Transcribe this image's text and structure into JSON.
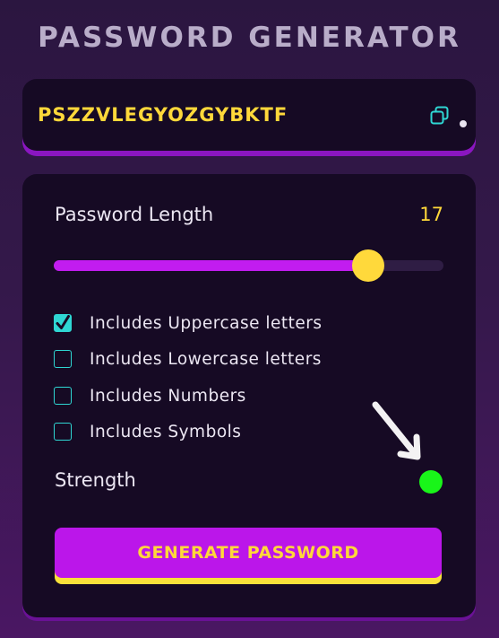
{
  "header": {
    "title": "PASSWORD GENERATOR"
  },
  "password": {
    "value": "PSZZVLEGYOZGYBKTF",
    "copy_icon": "copy-icon"
  },
  "settings": {
    "length_label": "Password Length",
    "length_value": "17",
    "slider": {
      "min": 0,
      "max": 21,
      "value": 17
    },
    "options": [
      {
        "label": "Includes Uppercase letters",
        "checked": true
      },
      {
        "label": "Includes Lowercase letters",
        "checked": false
      },
      {
        "label": "Includes Numbers",
        "checked": false
      },
      {
        "label": "Includes Symbols",
        "checked": false
      }
    ],
    "strength_label": "Strength",
    "strength_color": "#19f519"
  },
  "actions": {
    "generate_label": "GENERATE PASSWORD"
  },
  "colors": {
    "accent": "#c21cf0",
    "highlight": "#ffd83a",
    "checkbox": "#2fd6d3",
    "panel": "#160a24"
  }
}
